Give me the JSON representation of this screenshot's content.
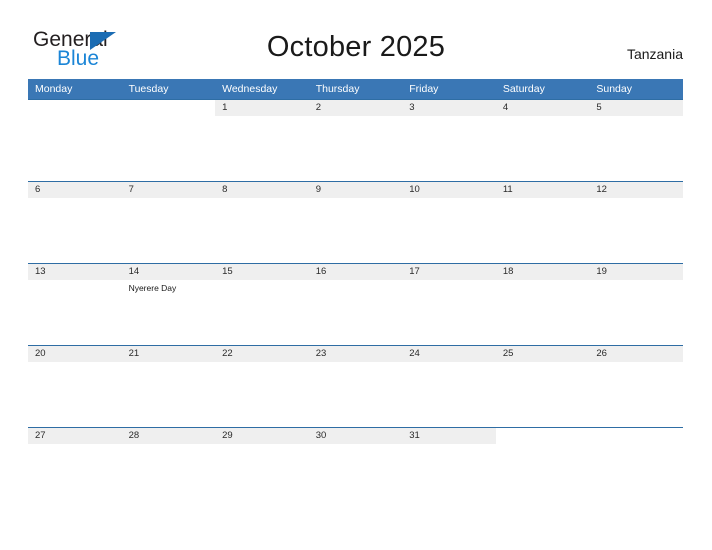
{
  "brand": {
    "line1": "General",
    "line2": "Blue",
    "flag_icon": "blue-triangle-flag",
    "color_line1": "#231f20",
    "color_line2": "#1b85d6",
    "color_flag": "#1b6cb3"
  },
  "header": {
    "title": "October 2025",
    "region": "Tanzania"
  },
  "theme": {
    "header_blue": "#3a77b5",
    "row_divider_blue": "#2e6da4",
    "day_band_gray": "#efefef"
  },
  "calendar": {
    "weekday_headers": [
      "Monday",
      "Tuesday",
      "Wednesday",
      "Thursday",
      "Friday",
      "Saturday",
      "Sunday"
    ],
    "weeks": [
      [
        {
          "day": "",
          "events": []
        },
        {
          "day": "",
          "events": []
        },
        {
          "day": "1",
          "events": []
        },
        {
          "day": "2",
          "events": []
        },
        {
          "day": "3",
          "events": []
        },
        {
          "day": "4",
          "events": []
        },
        {
          "day": "5",
          "events": []
        }
      ],
      [
        {
          "day": "6",
          "events": []
        },
        {
          "day": "7",
          "events": []
        },
        {
          "day": "8",
          "events": []
        },
        {
          "day": "9",
          "events": []
        },
        {
          "day": "10",
          "events": []
        },
        {
          "day": "11",
          "events": []
        },
        {
          "day": "12",
          "events": []
        }
      ],
      [
        {
          "day": "13",
          "events": []
        },
        {
          "day": "14",
          "events": [
            "Nyerere Day"
          ]
        },
        {
          "day": "15",
          "events": []
        },
        {
          "day": "16",
          "events": []
        },
        {
          "day": "17",
          "events": []
        },
        {
          "day": "18",
          "events": []
        },
        {
          "day": "19",
          "events": []
        }
      ],
      [
        {
          "day": "20",
          "events": []
        },
        {
          "day": "21",
          "events": []
        },
        {
          "day": "22",
          "events": []
        },
        {
          "day": "23",
          "events": []
        },
        {
          "day": "24",
          "events": []
        },
        {
          "day": "25",
          "events": []
        },
        {
          "day": "26",
          "events": []
        }
      ],
      [
        {
          "day": "27",
          "events": []
        },
        {
          "day": "28",
          "events": []
        },
        {
          "day": "29",
          "events": []
        },
        {
          "day": "30",
          "events": []
        },
        {
          "day": "31",
          "events": []
        },
        {
          "day": "",
          "events": []
        },
        {
          "day": "",
          "events": []
        }
      ]
    ]
  }
}
